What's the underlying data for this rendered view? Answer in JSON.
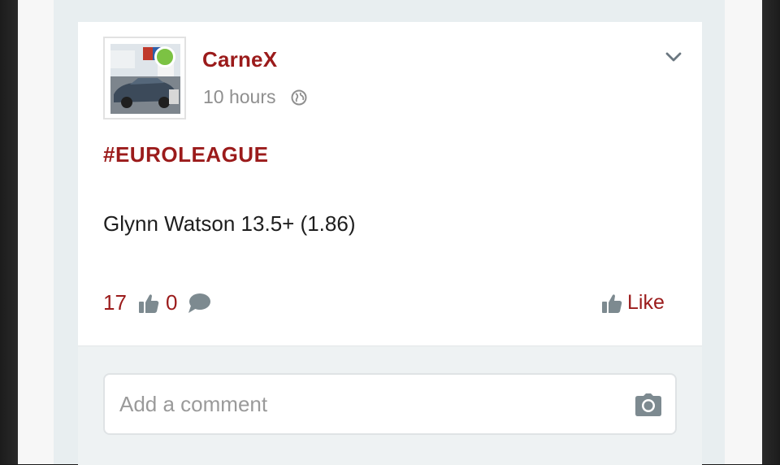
{
  "post": {
    "author": "CarneX",
    "time": "10 hours",
    "hashtag": "#EUROLEAGUE",
    "text": "Glynn Watson 13.5+ (1.86)",
    "likes": "17",
    "comments": "0",
    "like_label": "Like"
  },
  "comment": {
    "placeholder": "Add a comment"
  },
  "icons": {
    "globe": "globe-icon",
    "chevron": "chevron-down-icon",
    "thumb": "thumbs-up-icon",
    "bubble": "comment-bubble-icon",
    "camera": "camera-icon"
  },
  "colors": {
    "accent": "#9b1b1b",
    "online": "#7cc243",
    "icon_gray": "#7d8a90"
  }
}
